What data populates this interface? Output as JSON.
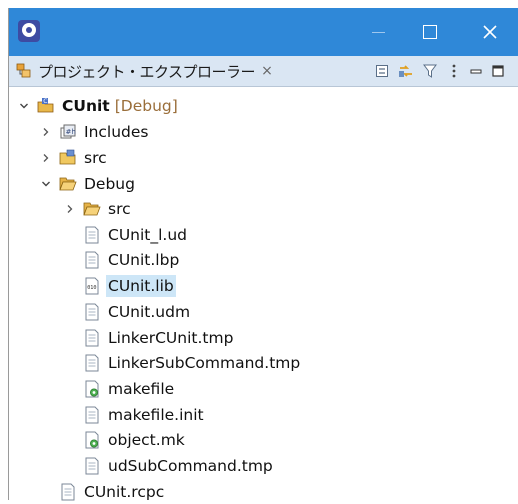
{
  "window": {
    "minimize_label": "—",
    "maximize_label": "☐",
    "close_label": "✕"
  },
  "view": {
    "tab_label": "プロジェクト・エクスプローラー",
    "tab_close": "×",
    "toolbar": [
      "collapse-all-icon",
      "link-with-editor-icon",
      "filter-icon",
      "view-menu-icon",
      "minimize-view-icon",
      "maximize-view-icon"
    ]
  },
  "tree": {
    "project": {
      "name": "CUnit",
      "config": "[Debug]",
      "expanded": true
    },
    "items": [
      {
        "label": "Includes",
        "icon": "includes-icon",
        "expanded": false
      },
      {
        "label": "src",
        "icon": "source-folder-icon",
        "expanded": false
      },
      {
        "label": "Debug",
        "icon": "folder-open-icon",
        "expanded": true
      },
      {
        "label": "src",
        "icon": "folder-icon",
        "expanded": false
      },
      {
        "label": "CUnit_l.ud",
        "icon": "file-icon"
      },
      {
        "label": "CUnit.lbp",
        "icon": "file-icon"
      },
      {
        "label": "CUnit.lib",
        "icon": "binary-file-icon",
        "selected": true
      },
      {
        "label": "CUnit.udm",
        "icon": "file-icon"
      },
      {
        "label": "LinkerCUnit.tmp",
        "icon": "file-icon"
      },
      {
        "label": "LinkerSubCommand.tmp",
        "icon": "file-icon"
      },
      {
        "label": "makefile",
        "icon": "makefile-icon"
      },
      {
        "label": "makefile.init",
        "icon": "file-icon"
      },
      {
        "label": "object.mk",
        "icon": "makefile-icon"
      },
      {
        "label": "udSubCommand.tmp",
        "icon": "file-icon"
      },
      {
        "label": "CUnit.rcpc",
        "icon": "file-icon"
      }
    ]
  },
  "colors": {
    "titlebar": "#2f88d8",
    "tabbar": "#dae6f3",
    "selection": "#cde6f7",
    "decoration": "#9a6e3a"
  }
}
